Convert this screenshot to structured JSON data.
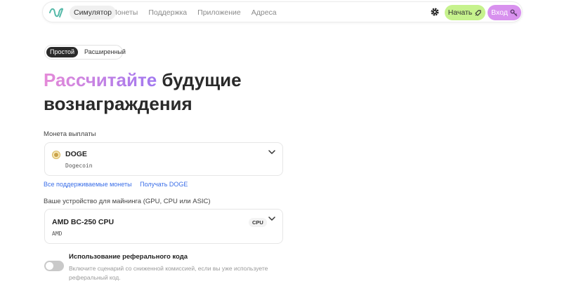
{
  "header": {
    "nav": [
      "Симулятор",
      "Монеты",
      "Поддержка",
      "Приложение",
      "Адреса"
    ],
    "start_label": "Начать",
    "login_label": "Вход",
    "icons": [
      "logo-icon",
      "gear-icon",
      "rocket-icon",
      "key-icon"
    ],
    "colors": {
      "start": "#c6f28d",
      "login": "#d891ee"
    }
  },
  "mode": {
    "simple": "Простой",
    "advanced": "Расширенный",
    "selected": "Простой"
  },
  "title": {
    "accent": "Рассчитайте",
    "rest_line1": "будущие",
    "line2": "вознаграждения"
  },
  "coin": {
    "label": "Монета выплаты",
    "name": "DOGE",
    "full_name": "Dogecoin",
    "links": [
      "Все поддерживаемые монеты",
      "Получать DOGE"
    ]
  },
  "device": {
    "label": "Ваше устройство для майнинга (GPU, CPU или ASIC)",
    "name": "AMD BC-250 CPU",
    "vendor": "AMD",
    "badge": "CPU"
  },
  "referral": {
    "title": "Использование реферального кода",
    "description": "Включите сценарий со сниженной комиссией, если вы уже используете реферальный код.",
    "enabled": false
  }
}
